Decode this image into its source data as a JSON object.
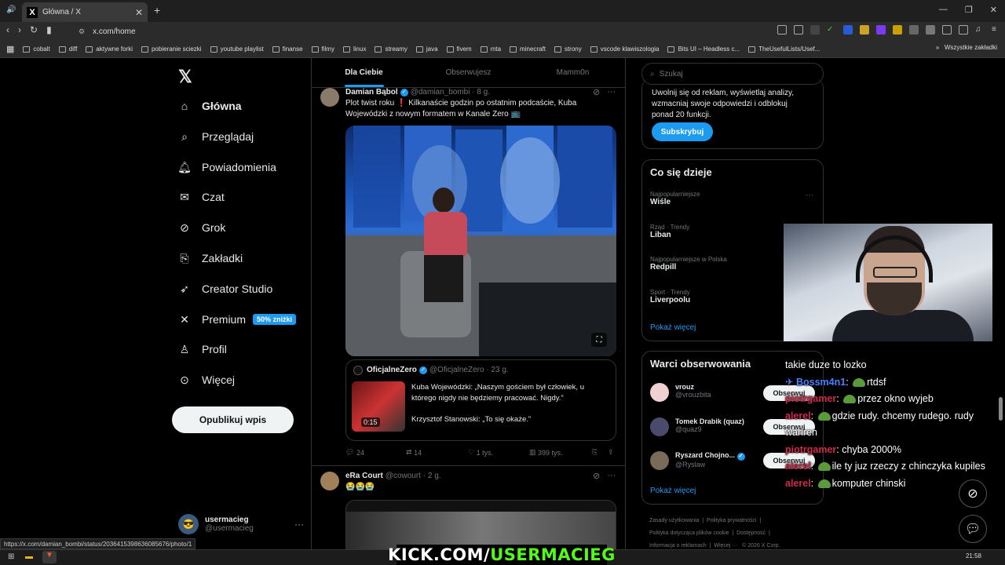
{
  "browser": {
    "tab_title": "Główna / X",
    "url": "x.com/home",
    "status_url": "https://x.com/damian_bombi/status/2036415398636085676/photo/1",
    "bookmarks": [
      "cobalt",
      "diff",
      "aktywne forki",
      "pobieranie sciezki",
      "youtube playlist",
      "finanse",
      "filmy",
      "linux",
      "streamy",
      "java",
      "fivem",
      "mta",
      "minecraft",
      "strony",
      "vscode klawiszologia",
      "Bits UI – Headless c...",
      "TheUsefulLists/Usef..."
    ],
    "all_bookmarks": "Wszystkie zakładki",
    "time": "21:58"
  },
  "nav": {
    "items": [
      {
        "label": "Główna",
        "icon": "home-icon"
      },
      {
        "label": "Przeglądaj",
        "icon": "search-icon"
      },
      {
        "label": "Powiadomienia",
        "icon": "bell-icon"
      },
      {
        "label": "Czat",
        "icon": "mail-icon"
      },
      {
        "label": "Grok",
        "icon": "grok-icon"
      },
      {
        "label": "Zakładki",
        "icon": "bookmark-icon"
      },
      {
        "label": "Creator Studio",
        "icon": "rocket-icon"
      },
      {
        "label": "Premium",
        "icon": "x-icon"
      },
      {
        "label": "Profil",
        "icon": "person-icon"
      },
      {
        "label": "Więcej",
        "icon": "more-circle-icon"
      }
    ],
    "premium_badge": "50% zniżki",
    "post_button": "Opublikuj wpis",
    "account_name": "usermacieg",
    "account_handle": "@usermacieg"
  },
  "feed": {
    "tabs": [
      "Dla Ciebie",
      "Obserwujesz",
      "Mamm0n"
    ],
    "post1": {
      "name": "Damian Bąbol",
      "handle": "@damian_bombi",
      "time": "· 8 g.",
      "text_a": "Plot twist roku",
      "text_b": "Kilkanaście godzin po ostatnim podcaście, Kuba Wojewódzki z nowym formatem w Kanale Zero",
      "quote_name": "OficjalneZero",
      "quote_handle": "@OficjalneZero",
      "quote_time": "· 23 g.",
      "quote_text1": "Kuba Wojewódzki: „Naszym gościem był człowiek, u którego nigdy nie będziemy pracować. Nigdy.”",
      "quote_text2": "Krzysztof Stanowski: „To się okaże.”",
      "video_time": "0:15",
      "replies": "24",
      "reposts": "14",
      "likes": "1 tys.",
      "views": "399 tys."
    },
    "post2": {
      "name": "eRa Court",
      "handle": "@cowourt",
      "time": "· 2 g.",
      "text": "😭😭😭"
    }
  },
  "right": {
    "search_placeholder": "Szukaj",
    "premium_text": "Uwolnij się od reklam, wyświetlaj analizy, wzmacniaj swoje odpowiedzi i odblokuj ponad 20 funkcji.",
    "subscribe": "Subskrybuj",
    "trends_title": "Co się dzieje",
    "trends": [
      {
        "cat": "Najpopularniejsze",
        "name": "Wiśle"
      },
      {
        "cat": "Rząd · Trendy",
        "name": "Liban"
      },
      {
        "cat": "Najpopularniejsze w Polska",
        "name": "Redpill"
      },
      {
        "cat": "Sport · Trendy",
        "name": "Liverpoolu"
      }
    ],
    "show_more": "Pokaż więcej",
    "follow_title": "Warci obserwowania",
    "follow": [
      {
        "name": "vrouz",
        "handle": "@vrouzbita"
      },
      {
        "name": "Tomek Drabik (quaz)",
        "handle": "@quaz9"
      },
      {
        "name": "Ryszard Chojno...",
        "handle": "@Ryslaw"
      }
    ],
    "follow_btn": "Obserwuj",
    "footer": [
      "Zasady użytkowania",
      "Polityka prywatności",
      "Polityka dotycząca plików cookie",
      "Dostępność",
      "Informacja o reklamach",
      "Więcej ···",
      "© 2026 X Corp."
    ]
  },
  "chat": {
    "messages": [
      {
        "user": "",
        "user_color": "#ffffff",
        "text": "takie duze to lozko",
        "emote": false
      },
      {
        "user": "Bossm4n1",
        "user_color": "#4a7fff",
        "text": "rtdsf",
        "emote": true
      },
      {
        "user": "piotrgamer",
        "user_color": "#d0294a",
        "text": "przez okno wyjeb",
        "emote": true
      },
      {
        "user": "alerel",
        "user_color": "#d0294a",
        "text": "gdzie rudy. chcemy rudego. rudy wariren",
        "emote": true
      },
      {
        "user": "piotrgamer",
        "user_color": "#d0294a",
        "text": "chyba 2000%",
        "emote": true
      },
      {
        "user": "alerel",
        "user_color": "#d0294a",
        "text": "ile ty juz rzeczy z chinczyka kupiles",
        "emote": true
      },
      {
        "user": "alerel",
        "user_color": "#d0294a",
        "text": "komputer chinski",
        "emote": true
      }
    ]
  },
  "overlay": {
    "kick_white": "KICK.COM/",
    "kick_green": "USERMACIEG"
  },
  "colors": {
    "accent": "#1d9bf0",
    "kick_green": "#53fc18",
    "bg": "#000000",
    "border": "#2f3336"
  }
}
